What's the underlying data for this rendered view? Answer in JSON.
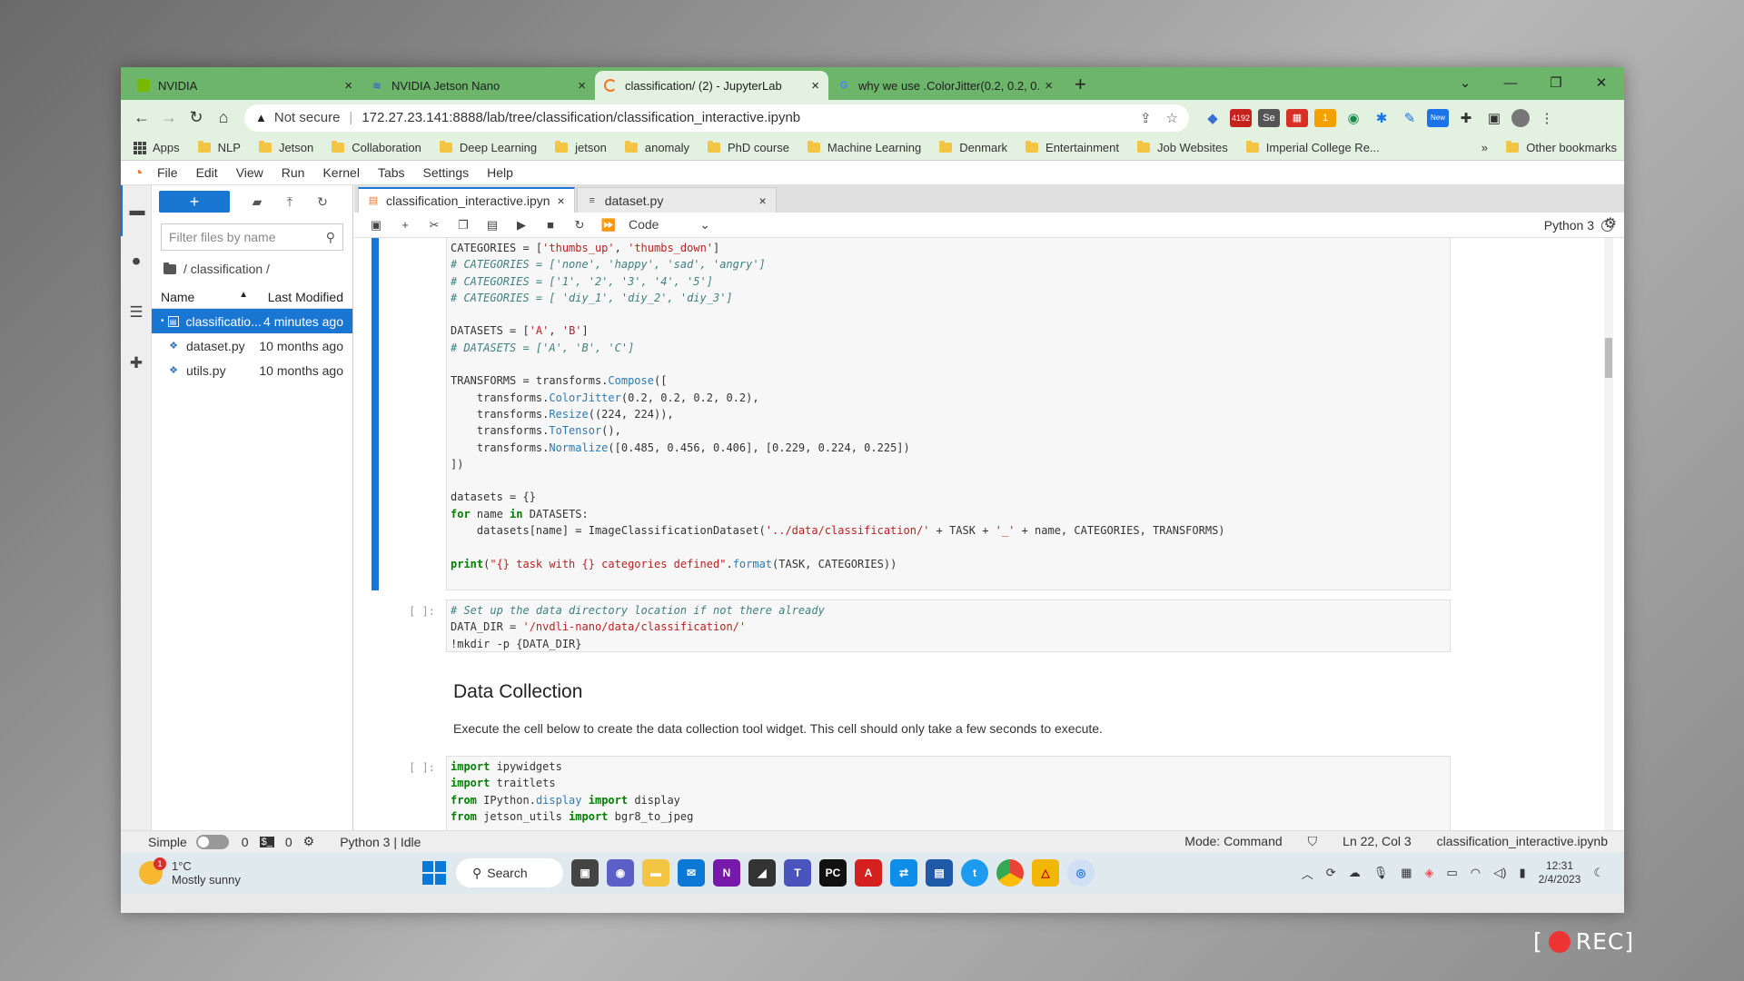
{
  "browser": {
    "tabs": [
      {
        "label": "NVIDIA",
        "icon": "nvidia-icon",
        "close": "×"
      },
      {
        "label": "NVIDIA Jetson Nano",
        "icon": "jetson-icon",
        "close": "×"
      },
      {
        "label": "classification/ (2) - JupyterLab",
        "icon": "loading-icon",
        "close": "×"
      },
      {
        "label": "why we use .ColorJitter(0.2, 0.2, 0.",
        "icon": "google-icon",
        "close": "×"
      }
    ],
    "new_tab": "+",
    "address": {
      "warning": "Not secure",
      "separator": "|",
      "url": "172.27.23.141:8888/lab/tree/classification/classification_interactive.ipynb"
    },
    "ext_badges": {
      "gmail": "4192",
      "new": "New",
      "sub": "1"
    },
    "bookmarks": [
      "Apps",
      "NLP",
      "Jetson",
      "Collaboration",
      "Deep Learning",
      "jetson",
      "anomaly",
      "PhD course",
      "Machine Learning",
      "Denmark",
      "Entertainment",
      "Job Websites",
      "Imperial College Re..."
    ],
    "bookmarks_more": "»",
    "other_bookmarks": "Other bookmarks"
  },
  "jupyter": {
    "menu": [
      "File",
      "Edit",
      "View",
      "Run",
      "Kernel",
      "Tabs",
      "Settings",
      "Help"
    ],
    "filebrowser": {
      "new_label": "+",
      "search_placeholder": "Filter files by name",
      "breadcrumb": "/ classification /",
      "col_name": "Name",
      "col_modified": "Last Modified",
      "sort_arrow": "▲",
      "files": [
        {
          "name": "classificatio...",
          "modified": "4 minutes ago",
          "type": "notebook"
        },
        {
          "name": "dataset.py",
          "modified": "10 months ago",
          "type": "python"
        },
        {
          "name": "utils.py",
          "modified": "10 months ago",
          "type": "python"
        }
      ]
    },
    "doc_tabs": [
      {
        "label": "classification_interactive.ipyn",
        "close": "×"
      },
      {
        "label": "dataset.py",
        "close": "×"
      }
    ],
    "cell_type": "Code",
    "cell_type_arrow": "⌄",
    "kernel": "Python 3",
    "cells": {
      "prompt_empty": "[ ]:",
      "cell2_comment": "# Set up the data directory location if not there already",
      "cell2_line2a": "DATA_DIR = ",
      "cell2_line2b": "'/nvdli-nano/data/classification/'",
      "cell2_line3": "!mkdir -p {DATA_DIR}",
      "section_title": "Data Collection",
      "section_text": "Execute the cell below to create the data collection tool widget. This cell should only take a few seconds to execute."
    },
    "status": {
      "mode_label": "Simple",
      "count1": "0",
      "count2": "0",
      "kernel_status": "Python 3 | Idle",
      "mode": "Mode: Command",
      "position": "Ln 22, Col 3",
      "filename": "classification_interactive.ipynb"
    }
  },
  "taskbar": {
    "weather_temp": "1°C",
    "weather_desc": "Mostly sunny",
    "weather_badge": "1",
    "search": "Search",
    "time": "12:31",
    "date": "2/4/2023"
  },
  "recording": "REC",
  "recording_open": "[",
  "recording_close": "]"
}
